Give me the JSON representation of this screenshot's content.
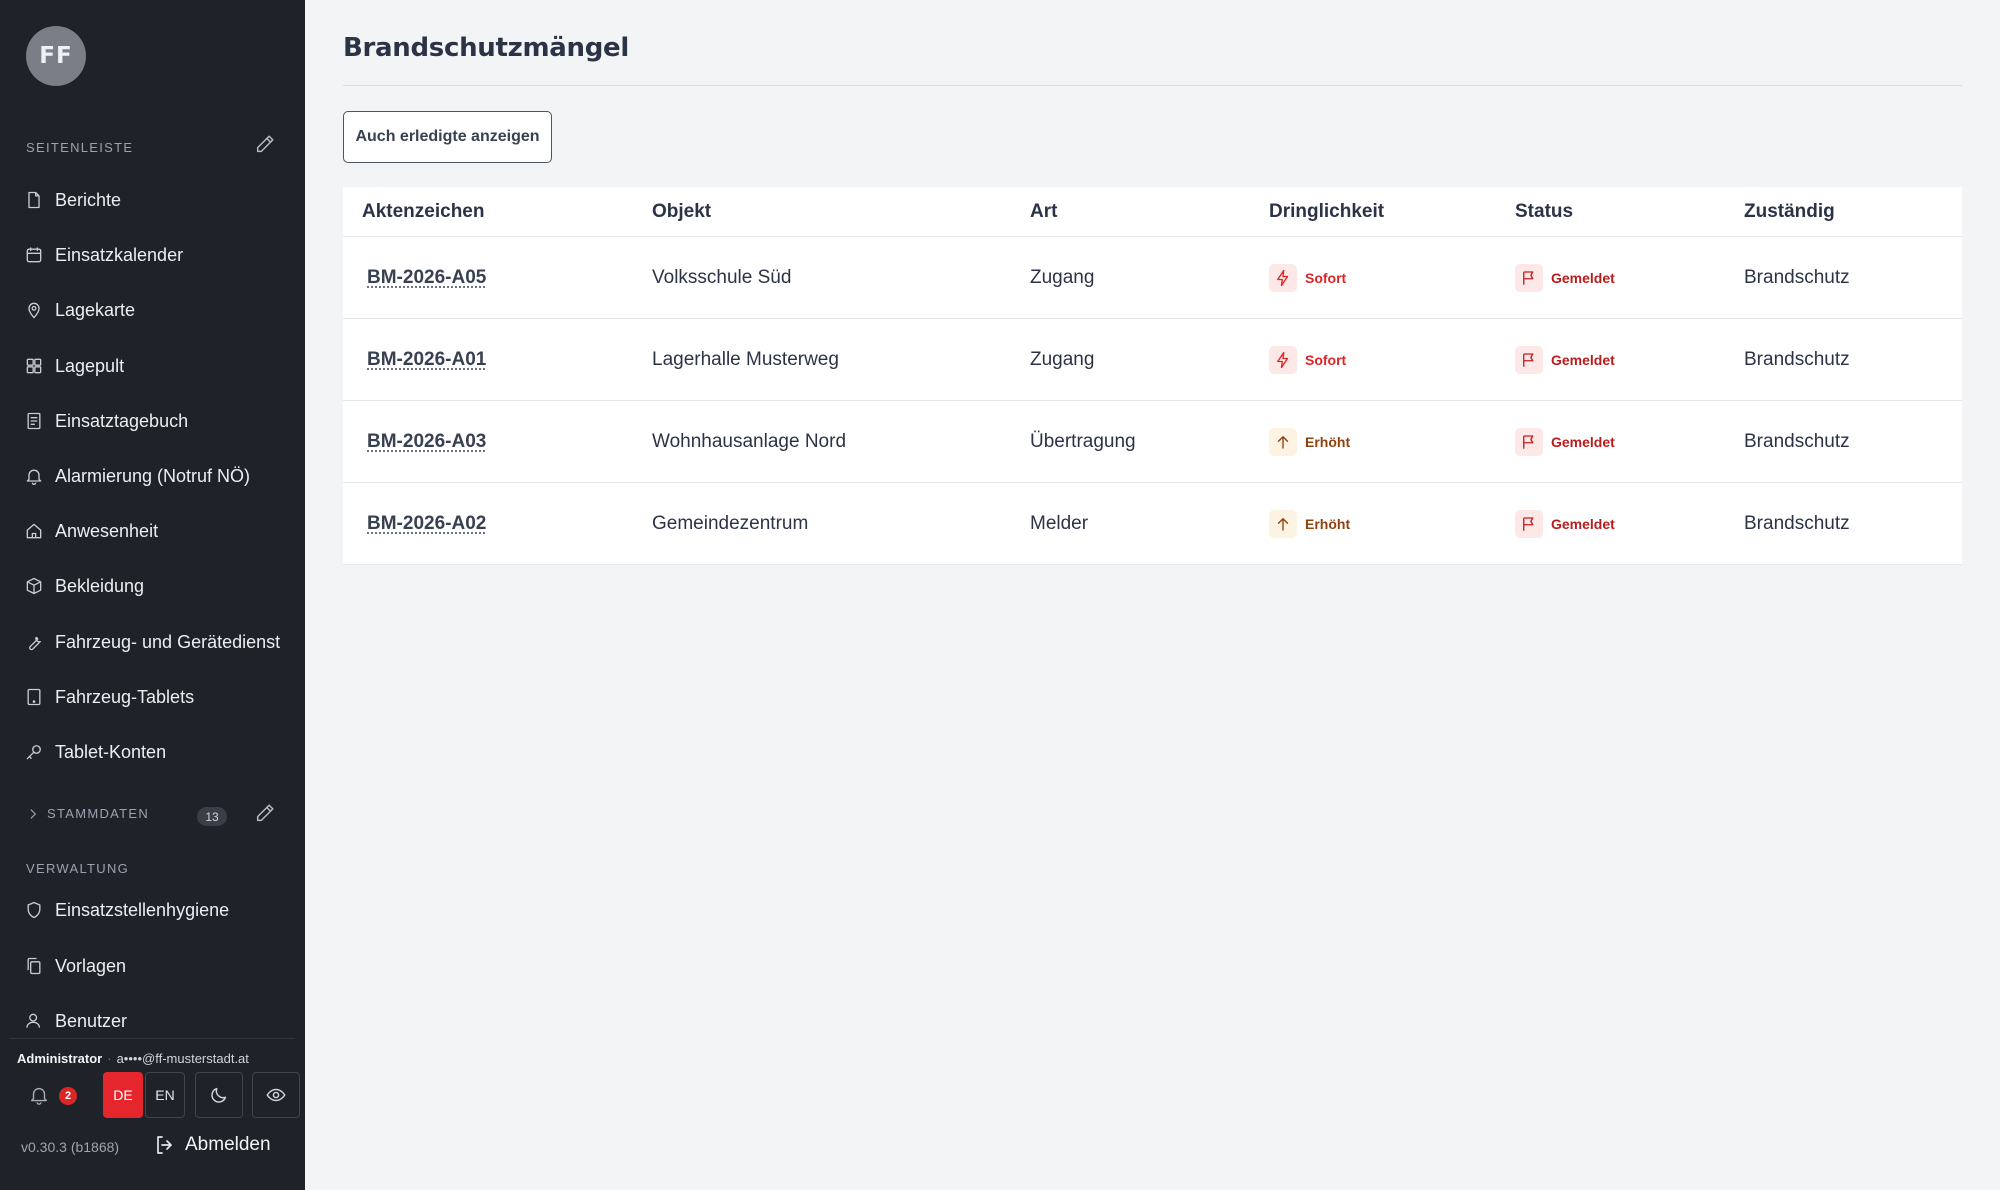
{
  "sidebar": {
    "avatar": "FF",
    "section_label": "SEITENLEISTE",
    "items": [
      {
        "label": "Berichte",
        "icon": "file-icon"
      },
      {
        "label": "Einsatzkalender",
        "icon": "calendar-icon"
      },
      {
        "label": "Lagekarte",
        "icon": "map-pin-icon"
      },
      {
        "label": "Lagepult",
        "icon": "grid-icon"
      },
      {
        "label": "Einsatztagebuch",
        "icon": "journal-icon"
      },
      {
        "label": "Alarmierung (Notruf NÖ)",
        "icon": "bell-icon"
      },
      {
        "label": "Anwesenheit",
        "icon": "home-icon"
      },
      {
        "label": "Bekleidung",
        "icon": "box-icon"
      },
      {
        "label": "Fahrzeug- und Gerätedienst",
        "icon": "wrench-icon"
      },
      {
        "label": "Fahrzeug-Tablets",
        "icon": "tablet-icon"
      },
      {
        "label": "Tablet-Konten",
        "icon": "key-icon"
      }
    ],
    "stammdaten_label": "STAMMDATEN",
    "stammdaten_count": "13",
    "verwaltung_label": "VERWALTUNG",
    "admin_items": [
      {
        "label": "Einsatzstellenhygiene",
        "icon": "shield-icon"
      },
      {
        "label": "Vorlagen",
        "icon": "copy-icon"
      },
      {
        "label": "Benutzer",
        "icon": "user-icon"
      }
    ],
    "user_role": "Administrator",
    "user_email": "a••••@ff-musterstadt.at",
    "notification_count": "2",
    "lang_de": "DE",
    "lang_en": "EN",
    "version": "v0.30.3 (b1868)",
    "logout": "Abmelden"
  },
  "main": {
    "title": "Brandschutzmängel",
    "show_done_button": "Auch erledigte anzeigen",
    "columns": [
      "Aktenzeichen",
      "Objekt",
      "Art",
      "Dringlichkeit",
      "Status",
      "Zuständig"
    ],
    "rows": [
      {
        "ref": "BM-2026-A05",
        "object": "Volksschule Süd",
        "type": "Zugang",
        "urgency": "Sofort",
        "status": "Gemeldet",
        "owner": "Brandschutz"
      },
      {
        "ref": "BM-2026-A01",
        "object": "Lagerhalle Musterweg",
        "type": "Zugang",
        "urgency": "Sofort",
        "status": "Gemeldet",
        "owner": "Brandschutz"
      },
      {
        "ref": "BM-2026-A03",
        "object": "Wohnhausanlage Nord",
        "type": "Übertragung",
        "urgency": "Erhöht",
        "status": "Gemeldet",
        "owner": "Brandschutz"
      },
      {
        "ref": "BM-2026-A02",
        "object": "Gemeindezentrum",
        "type": "Melder",
        "urgency": "Erhöht",
        "status": "Gemeldet",
        "owner": "Brandschutz"
      }
    ]
  },
  "colors": {
    "sidebar_bg": "#1f2229",
    "urgent_red": "#dc2626",
    "elevated_amber": "#92400e",
    "status_red": "#b91c1c"
  }
}
